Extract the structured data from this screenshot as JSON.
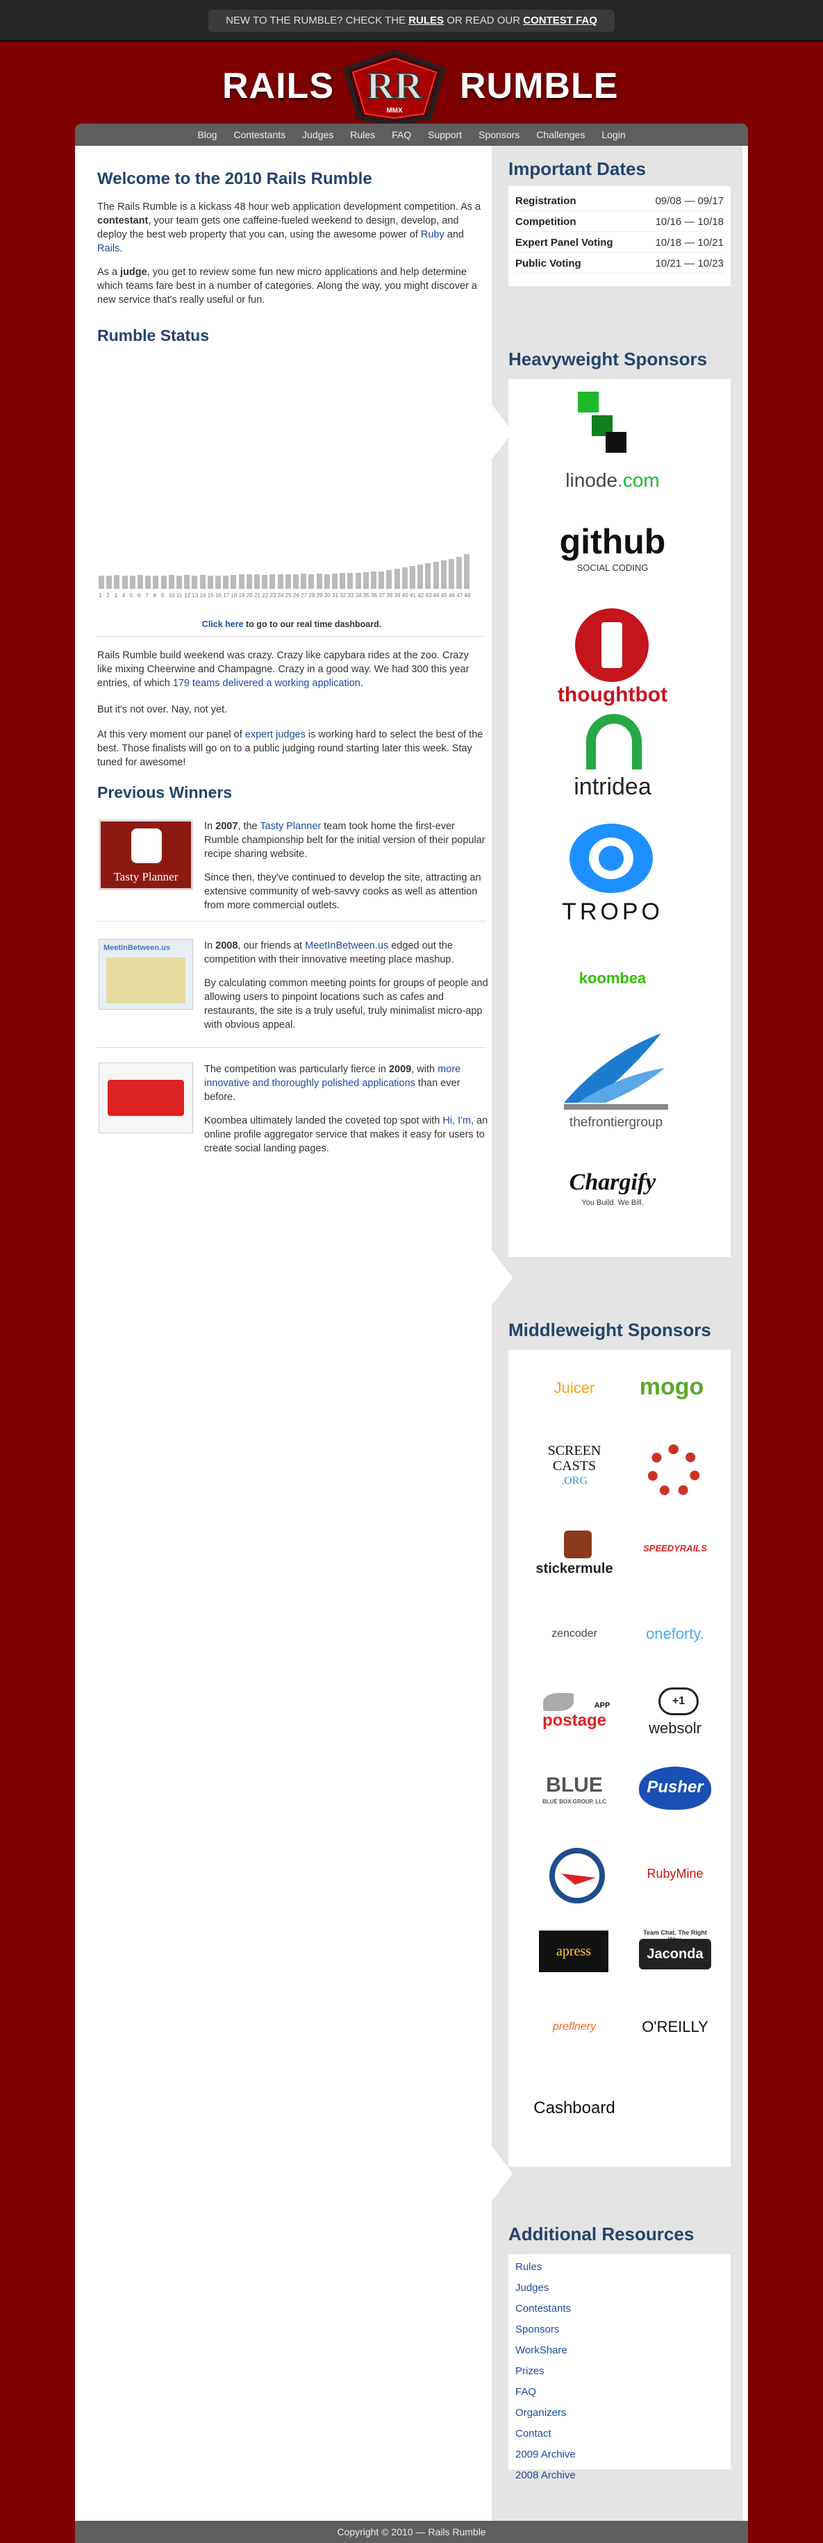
{
  "topbar": {
    "pre": "NEW TO THE RUMBLE? CHECK THE ",
    "rules": "RULES",
    "mid": " OR READ OUR ",
    "faq": "CONTEST FAQ"
  },
  "brand": {
    "left": "RAILS",
    "right": "RUMBLE",
    "mark": "RR",
    "year": "MMX"
  },
  "nav": [
    "Blog",
    "Contestants",
    "Judges",
    "Rules",
    "FAQ",
    "Support",
    "Sponsors",
    "Challenges",
    "Login"
  ],
  "welcome": {
    "title": "Welcome to the 2010 Rails Rumble",
    "p1a": "The Rails Rumble is a kickass 48 hour web application development competition. As a ",
    "p1b": "contestant",
    "p1c": ", your team gets one caffeine-fueled weekend to design, develop, and deploy the best web property that you can, using the awesome power of ",
    "ruby": "Ruby",
    "and": " and ",
    "rails": "Rails",
    "dot": ".",
    "p2a": "As a ",
    "p2b": "judge",
    "p2c": ", you get to review some fun new micro applications and help determine which teams fare best in a number of categories. Along the way, you might discover a new service that's really useful or fun."
  },
  "status": {
    "title": "Rumble Status",
    "dash_link": "Click here",
    "dash_rest": " to go to our real time dashboard.",
    "p1a": "Rails Rumble build weekend was crazy. Crazy like capybara rides at the zoo. Crazy like mixing Cheerwine and Champagne. Crazy in a good way. We had 300 this year entries, of which ",
    "p1link": "179 teams delivered a working application",
    "p1b": ".",
    "p2": "But it's not over. Nay, not yet.",
    "p3a": "At this very moment our panel of ",
    "p3link": "expert judges",
    "p3b": " is working hard to select the best of the best. Those finalists will go on to a public judging round starting later this week. Stay tuned for awesome!"
  },
  "chart_data": {
    "type": "bar",
    "categories": [
      "1",
      "2",
      "3",
      "4",
      "5",
      "6",
      "7",
      "8",
      "9",
      "10",
      "11",
      "12",
      "13",
      "14",
      "15",
      "16",
      "17",
      "18",
      "19",
      "20",
      "21",
      "22",
      "23",
      "24",
      "25",
      "26",
      "27",
      "28",
      "29",
      "30",
      "31",
      "32",
      "33",
      "34",
      "35",
      "36",
      "37",
      "38",
      "39",
      "40",
      "41",
      "42",
      "43",
      "44",
      "45",
      "46",
      "47",
      "48"
    ],
    "values": [
      20,
      20,
      21,
      20,
      20,
      21,
      20,
      20,
      20,
      21,
      20,
      21,
      20,
      21,
      20,
      20,
      20,
      21,
      22,
      22,
      22,
      21,
      22,
      22,
      22,
      22,
      23,
      22,
      23,
      22,
      23,
      24,
      24,
      24,
      25,
      26,
      26,
      28,
      30,
      32,
      34,
      36,
      38,
      40,
      42,
      44,
      48,
      52
    ],
    "title": "",
    "xlabel": "",
    "ylabel": ""
  },
  "winners": {
    "title": "Previous Winners",
    "w1a": "In ",
    "w1year": "2007",
    "w1b": ", the ",
    "w1link": "Tasty Planner",
    "w1c": " team took home the first-ever Rumble championship belt for the initial version of their popular recipe sharing website.",
    "w1p2": "Since then, they've continued to develop the site, attracting an extensive community of web-savvy cooks as well as attention from more commercial outlets.",
    "w1thumb": "Tasty Planner",
    "w2a": "In ",
    "w2year": "2008",
    "w2b": ", our friends at ",
    "w2link": "MeetInBetween.us",
    "w2c": " edged out the competition with their innovative meeting place mashup.",
    "w2p2": "By calculating common meeting points for groups of people and allowing users to pinpoint locations such as cafes and restaurants, the site is a truly useful, truly minimalist micro-app with obvious appeal.",
    "w2thumb": "MeetInBetween.us",
    "w3a": "The competition was particularly fierce in ",
    "w3year": "2009",
    "w3b": ", with ",
    "w3link": "more innovative and thoroughly polished applications",
    "w3c": " than ever before.",
    "w3p2a": "Koombea ultimately landed the coveted top spot with ",
    "w3link2": "Hi, I'm",
    "w3p2b": ", an online profile aggregator service that makes it easy for users to create social landing pages."
  },
  "dates": {
    "title": "Important Dates",
    "rows": [
      {
        "label": "Registration",
        "value": "09/08 — 09/17"
      },
      {
        "label": "Competition",
        "value": "10/16 — 10/18"
      },
      {
        "label": "Expert Panel Voting",
        "value": "10/18 — 10/21"
      },
      {
        "label": "Public Voting",
        "value": "10/21 — 10/23"
      }
    ]
  },
  "heavy": {
    "title": "Heavyweight Sponsors",
    "linode": "linode",
    "linode_tld": ".com",
    "github": "github",
    "github_sub": "SOCIAL CODING",
    "thoughtbot": "thoughtbot",
    "intridea": "intridea",
    "tropo": "TROPO",
    "koombea": "koombea",
    "frontier": "thefrontiergroup",
    "chargify": "Chargify",
    "chargify_sub": "You Build. We Bill."
  },
  "middle": {
    "title": "Middleweight Sponsors",
    "juicer": "Juicer",
    "mogo": "mogo",
    "screencasts1": "SCREEN",
    "screencasts2": "CASTS",
    "screencasts3": ".ORG",
    "stickermule": "stickermule",
    "speedyrails": "SPEEDYRAILS",
    "zencoder": "zencoder",
    "oneforty": "oneforty.",
    "postage1": "APP",
    "postage2": "postage",
    "websolr": "websolr",
    "websolr_badge": "+1",
    "blue": "BLUE",
    "blue_sub": "BLUE BOX GROUP, LLC",
    "pusher": "Pusher",
    "rubymine": "RubyMine",
    "apress": "apress",
    "jaconda": "Jaconda",
    "jaconda_sub": "Team Chat. The Right Way.",
    "preflnery": "preflnery",
    "oreilly": "O'REILLY",
    "cashboard": "Cashboard"
  },
  "resources": {
    "title": "Additional Resources",
    "links": [
      "Rules",
      "Judges",
      "Contestants",
      "Sponsors",
      "WorkShare",
      "Prizes",
      "FAQ",
      "Organizers",
      "Contact",
      "2009 Archive",
      "2008 Archive"
    ]
  },
  "footer": "Copyright © 2010 — Rails Rumble",
  "colors": {
    "bg": "#7c0000",
    "heading": "#24446e",
    "link": "#1a4c9c",
    "nav": "#5e5e5e"
  }
}
